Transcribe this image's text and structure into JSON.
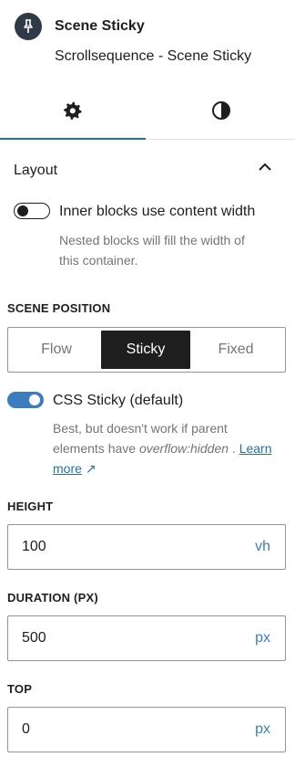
{
  "block": {
    "icon": "pin-icon",
    "title": "Scene Sticky",
    "description": "Scrollsequence - Scene Sticky"
  },
  "tabs": [
    {
      "icon": "gear-icon",
      "active": true
    },
    {
      "icon": "contrast-icon",
      "active": false
    }
  ],
  "panel": {
    "title": "Layout",
    "expanded": true
  },
  "inner_blocks": {
    "label": "Inner blocks use content width",
    "enabled": false,
    "help_line1": "Nested blocks will fill the width of",
    "help_line2": "this container."
  },
  "scene_position": {
    "label": "SCENE POSITION",
    "options": [
      "Flow",
      "Sticky",
      "Fixed"
    ],
    "selected": "Sticky"
  },
  "css_sticky": {
    "label": "CSS Sticky (default)",
    "enabled": true,
    "help_line1": "Best, but doesn't work if parent",
    "help_prefix": "elements have ",
    "help_code": "overflow:hidden",
    "help_suffix": " . ",
    "link_word1": "Learn",
    "link_word2": "more",
    "link_icon": "external-link-icon"
  },
  "height": {
    "label": "HEIGHT",
    "value": "100",
    "unit": "vh"
  },
  "duration": {
    "label": "DURATION (PX)",
    "value": "500",
    "unit": "px"
  },
  "top": {
    "label": "TOP",
    "value": "0",
    "unit": "px"
  },
  "colors": {
    "accent": "#3b7ec0",
    "link": "#2271b1",
    "dark": "#1e1e1e",
    "muted": "#757575"
  }
}
